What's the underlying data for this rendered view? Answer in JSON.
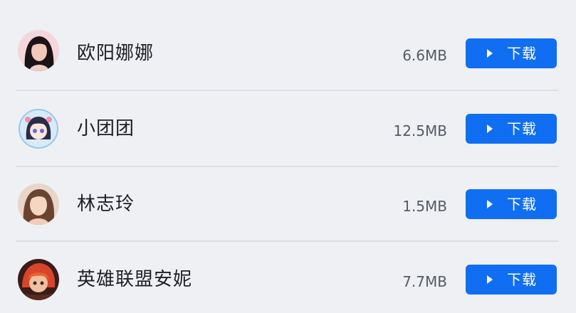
{
  "colors": {
    "background": "#eef0f4",
    "accent": "#0f6ef2",
    "divider": "#dcdfe5"
  },
  "items": [
    {
      "name": "欧阳娜娜",
      "size": "6.6MB",
      "button_label": "下载",
      "avatar_icon": "avatar-woman-dark-hair"
    },
    {
      "name": "小团团",
      "size": "12.5MB",
      "button_label": "下载",
      "avatar_icon": "avatar-anime-girl"
    },
    {
      "name": "林志玲",
      "size": "1.5MB",
      "button_label": "下载",
      "avatar_icon": "avatar-woman-brown-hair"
    },
    {
      "name": "英雄联盟安妮",
      "size": "7.7MB",
      "button_label": "下载",
      "avatar_icon": "avatar-game-character"
    }
  ]
}
